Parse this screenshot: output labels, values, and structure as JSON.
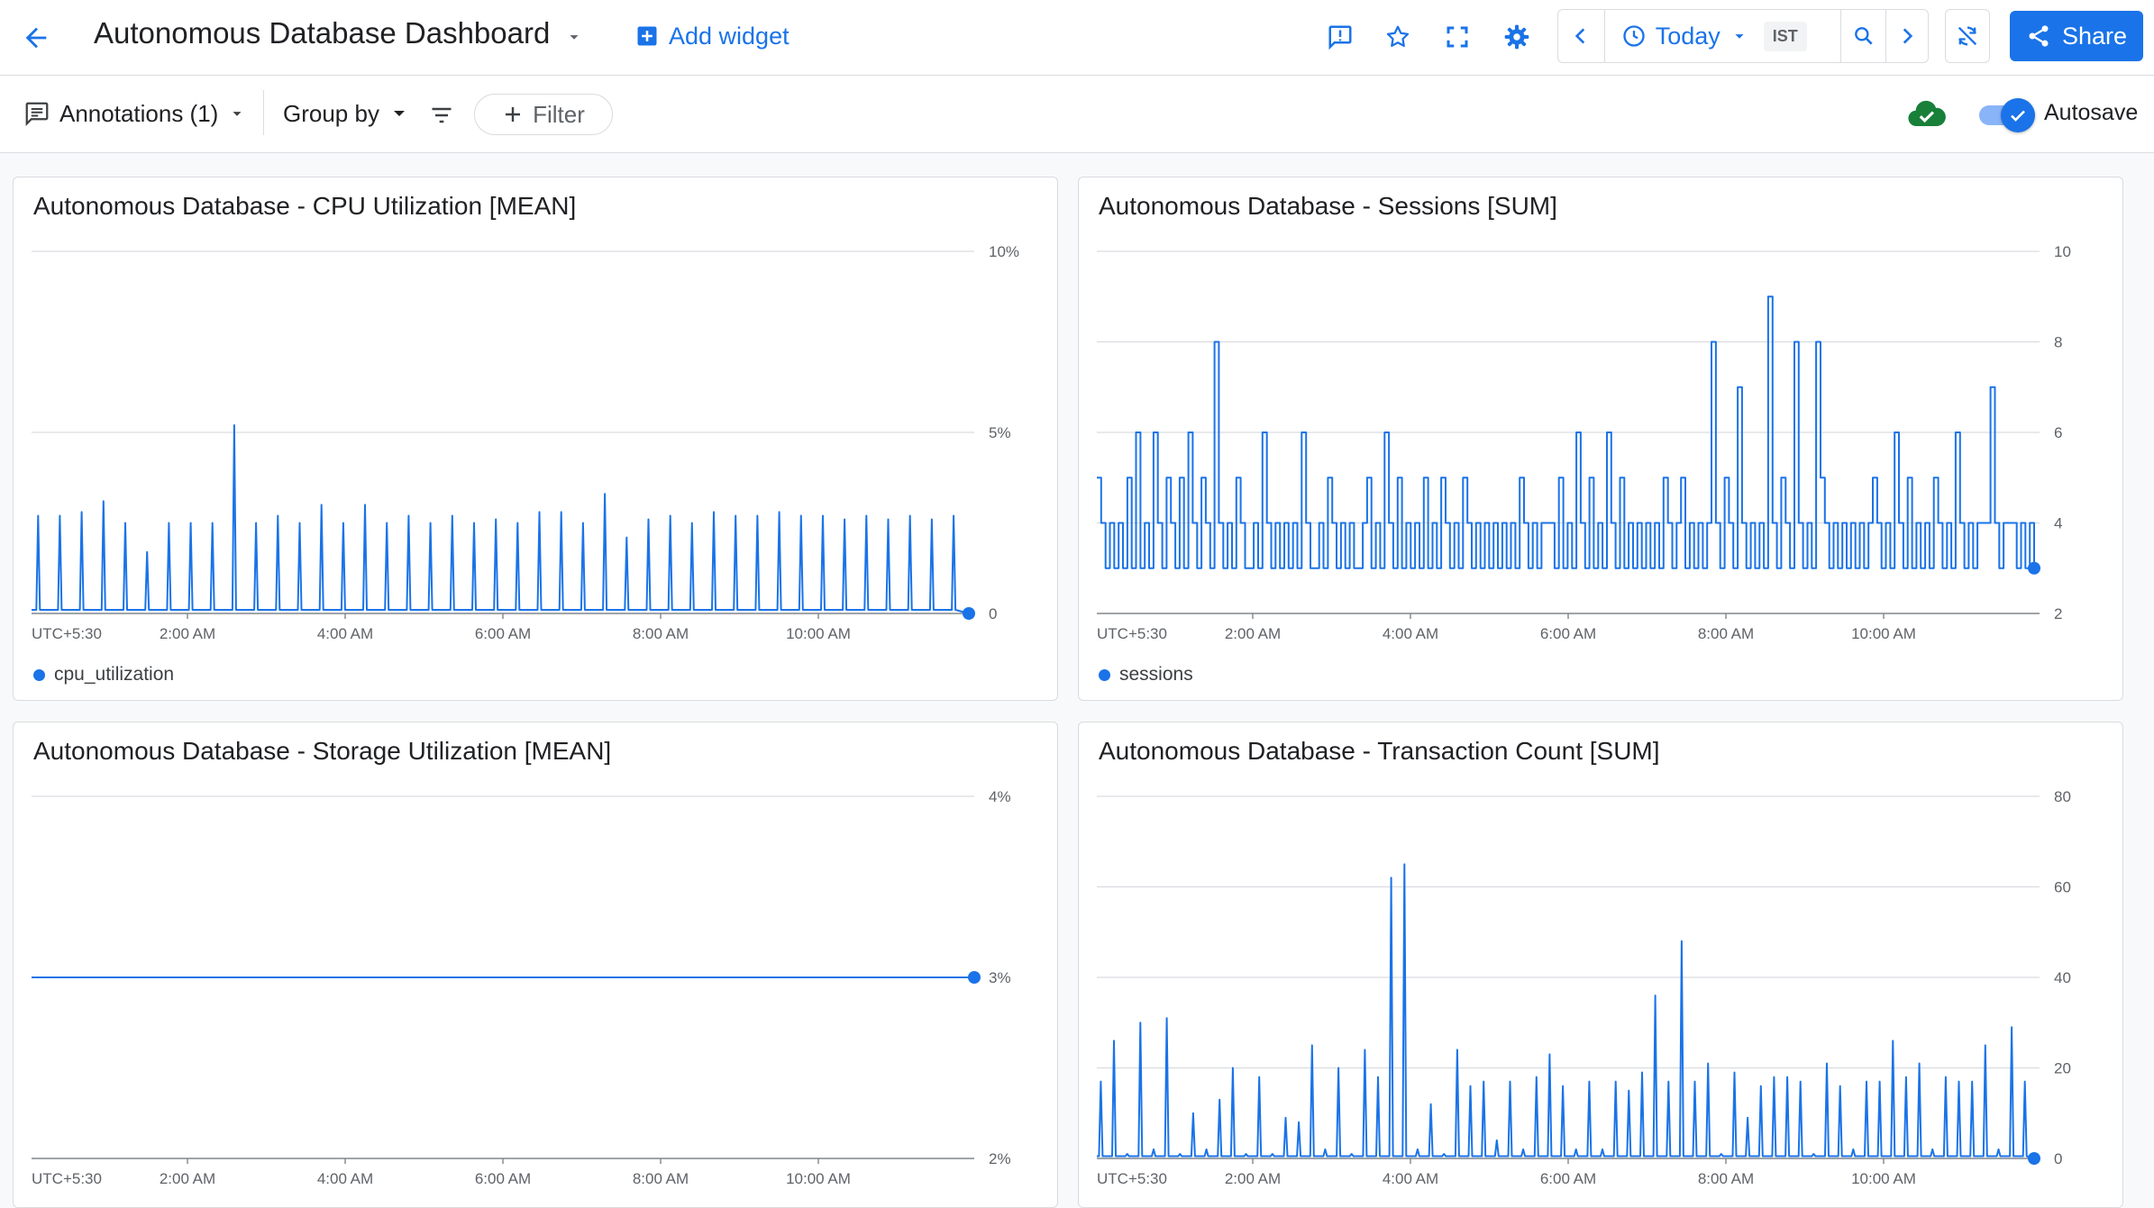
{
  "header": {
    "title": "Autonomous Database Dashboard",
    "add_widget_label": "Add widget",
    "time_range": "Today",
    "timezone": "IST",
    "share_label": "Share"
  },
  "toolbar": {
    "annotations_label": "Annotations (1)",
    "group_by_label": "Group by",
    "filter_label": "Filter",
    "autosave_label": "Autosave",
    "autosave_enabled": true
  },
  "colors": {
    "accent": "#1a73e8",
    "saved_green": "#188038",
    "grid": "#dadce0"
  },
  "x_axis_labels": [
    "UTC+5:30",
    "2:00 AM",
    "4:00 AM",
    "6:00 AM",
    "8:00 AM",
    "10:00 AM"
  ],
  "chart_data": [
    {
      "type": "line",
      "title": "Autonomous Database - CPU Utilization [MEAN]",
      "series": [
        {
          "name": "cpu_utilization"
        }
      ],
      "ylim": [
        0,
        10
      ],
      "y_ticks": [
        "10%",
        "5%",
        "0"
      ],
      "spike_values": [
        2.7,
        2.7,
        2.8,
        3.1,
        2.5,
        1.7,
        2.5,
        2.5,
        2.5,
        5.2,
        2.5,
        2.7,
        2.5,
        3.0,
        2.5,
        3.0,
        2.5,
        2.7,
        2.5,
        2.7,
        2.5,
        2.6,
        2.5,
        2.8,
        2.8,
        2.5,
        3.3,
        2.1,
        2.6,
        2.7,
        2.5,
        2.8,
        2.7,
        2.7,
        2.8,
        2.7,
        2.7,
        2.6,
        2.7,
        2.6,
        2.7,
        2.6,
        2.7
      ],
      "baseline": 0.1,
      "last_value": 0
    },
    {
      "type": "line",
      "title": "Autonomous Database - Sessions [SUM]",
      "series": [
        {
          "name": "sessions"
        }
      ],
      "ylim": [
        2,
        10
      ],
      "y_ticks": [
        "10",
        "8",
        "6",
        "4",
        "2"
      ],
      "values": [
        5,
        4,
        3,
        4,
        3,
        4,
        3,
        5,
        3,
        6,
        3,
        4,
        3,
        6,
        4,
        3,
        5,
        4,
        3,
        5,
        3,
        6,
        4,
        3,
        5,
        4,
        3,
        8,
        4,
        3,
        4,
        3,
        5,
        4,
        3,
        3,
        4,
        3,
        6,
        4,
        3,
        4,
        3,
        4,
        3,
        4,
        3,
        6,
        4,
        3,
        3,
        4,
        3,
        5,
        4,
        3,
        4,
        3,
        4,
        3,
        3,
        4,
        5,
        3,
        4,
        3,
        6,
        4,
        3,
        5,
        3,
        4,
        3,
        4,
        3,
        5,
        3,
        4,
        3,
        5,
        4,
        3,
        4,
        3,
        5,
        4,
        3,
        4,
        3,
        4,
        3,
        4,
        3,
        4,
        3,
        4,
        3,
        5,
        4,
        3,
        4,
        3,
        4,
        4,
        4,
        3,
        5,
        3,
        4,
        3,
        6,
        4,
        3,
        5,
        3,
        4,
        3,
        6,
        4,
        3,
        5,
        3,
        4,
        3,
        4,
        3,
        4,
        3,
        4,
        3,
        5,
        4,
        3,
        4,
        5,
        3,
        4,
        3,
        4,
        3,
        4,
        8,
        4,
        3,
        5,
        4,
        3,
        7,
        4,
        3,
        4,
        3,
        4,
        3,
        9,
        4,
        3,
        5,
        4,
        3,
        8,
        4,
        3,
        4,
        3,
        8,
        5,
        4,
        3,
        4,
        3,
        4,
        3,
        4,
        3,
        4,
        3,
        4,
        5,
        4,
        3,
        4,
        3,
        6,
        4,
        3,
        5,
        3,
        4,
        3,
        4,
        3,
        5,
        4,
        3,
        4,
        3,
        6,
        4,
        3,
        4,
        3,
        4,
        4,
        4,
        7,
        4,
        3,
        4,
        4,
        4,
        3,
        4,
        3,
        4,
        3
      ],
      "last_value": 3
    },
    {
      "type": "line",
      "title": "Autonomous Database - Storage Utilization [MEAN]",
      "series": [
        {
          "name": ""
        }
      ],
      "ylim": [
        2,
        4
      ],
      "y_ticks": [
        "4%",
        "3%",
        "2%"
      ],
      "values": [
        3,
        3
      ],
      "last_value": 3
    },
    {
      "type": "line",
      "title": "Autonomous Database - Transaction Count [SUM]",
      "series": [
        {
          "name": ""
        }
      ],
      "ylim": [
        0,
        80
      ],
      "y_ticks": [
        "80",
        "60",
        "40",
        "20",
        "0"
      ],
      "spike_values": [
        17,
        26,
        1,
        30,
        2,
        31,
        1,
        10,
        2,
        13,
        20,
        1,
        18,
        1,
        9,
        8,
        25,
        2,
        20,
        1,
        24,
        18,
        62,
        65,
        2,
        12,
        1,
        24,
        16,
        17,
        4,
        17,
        2,
        18,
        23,
        16,
        2,
        17,
        2,
        17,
        15,
        19,
        36,
        17,
        48,
        17,
        21,
        1,
        19,
        9,
        16,
        18,
        18,
        17,
        1,
        21,
        16,
        2,
        17,
        17,
        26,
        18,
        21,
        2,
        18,
        17,
        17,
        25,
        2,
        29,
        17
      ],
      "baseline": 0.5,
      "last_value": 0
    }
  ]
}
